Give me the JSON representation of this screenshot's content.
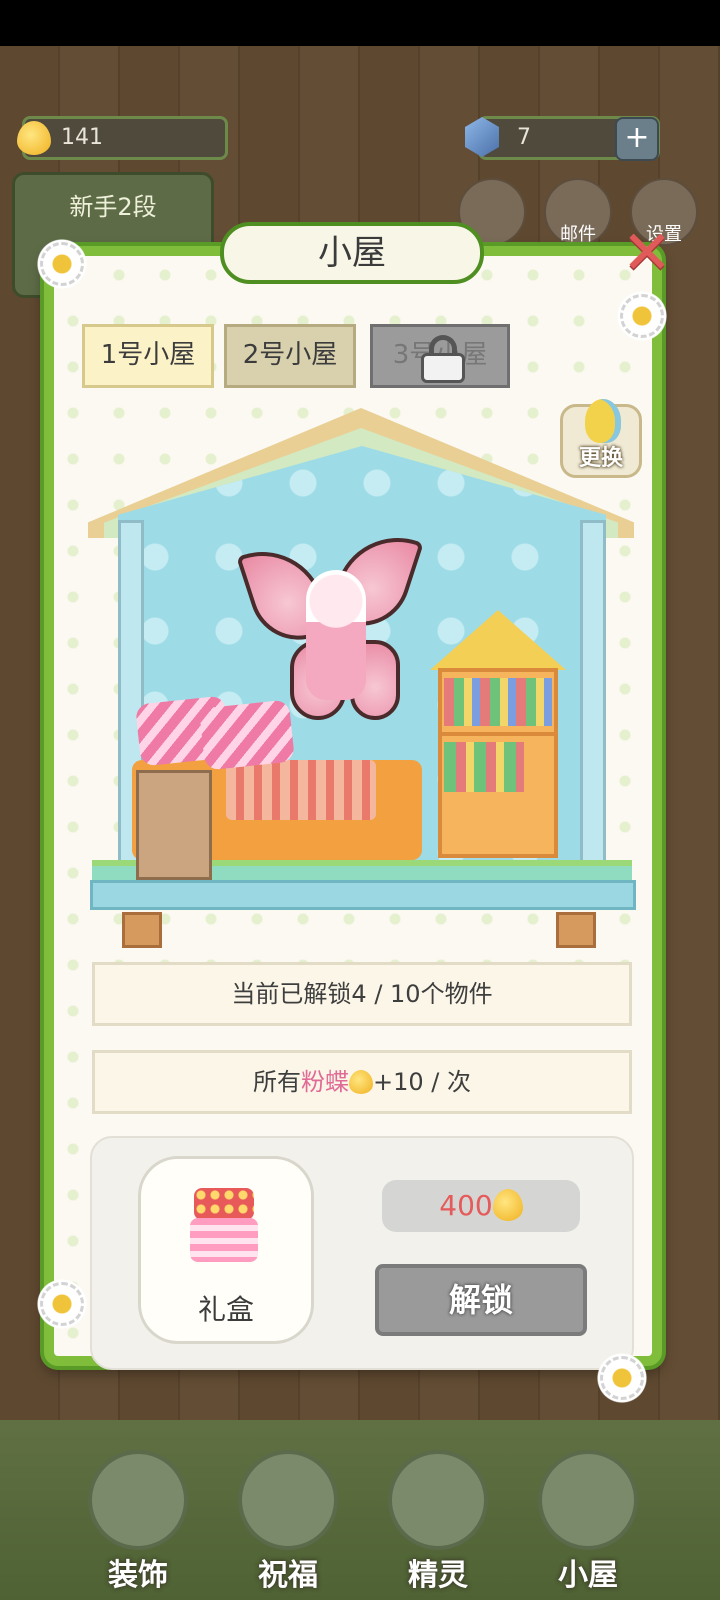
{
  "currency": {
    "gold": "141",
    "gems": "7"
  },
  "level": {
    "badge": "新手2段"
  },
  "top_icons": [
    {
      "label": "",
      "icon": "berry-icon"
    },
    {
      "label": "邮件",
      "icon": "mail-icon"
    },
    {
      "label": "设置",
      "icon": "gear-icon"
    }
  ],
  "dialog": {
    "title": "小屋",
    "tabs": [
      "1号小屋",
      "2号小屋",
      "3号小屋"
    ],
    "swap_label": "更换",
    "unlocked_info": "当前已解锁4 / 10个物件",
    "bonus": {
      "prefix": "所有",
      "highlight": "粉蝶",
      "suffix": "+10 / 次"
    },
    "reward_label": "礼盒",
    "price": "400",
    "unlock_label": "解锁"
  },
  "bottom_nav": [
    {
      "label": "装饰",
      "icon": "plant-icon"
    },
    {
      "label": "祝福",
      "icon": "blessing-icon"
    },
    {
      "label": "精灵",
      "icon": "fairy-icon"
    },
    {
      "label": "小屋",
      "icon": "house-icon"
    }
  ],
  "colors": {
    "vine_green": "#7fbd3a",
    "price_red": "#e55a5a",
    "accent_pink": "#e06b97"
  }
}
